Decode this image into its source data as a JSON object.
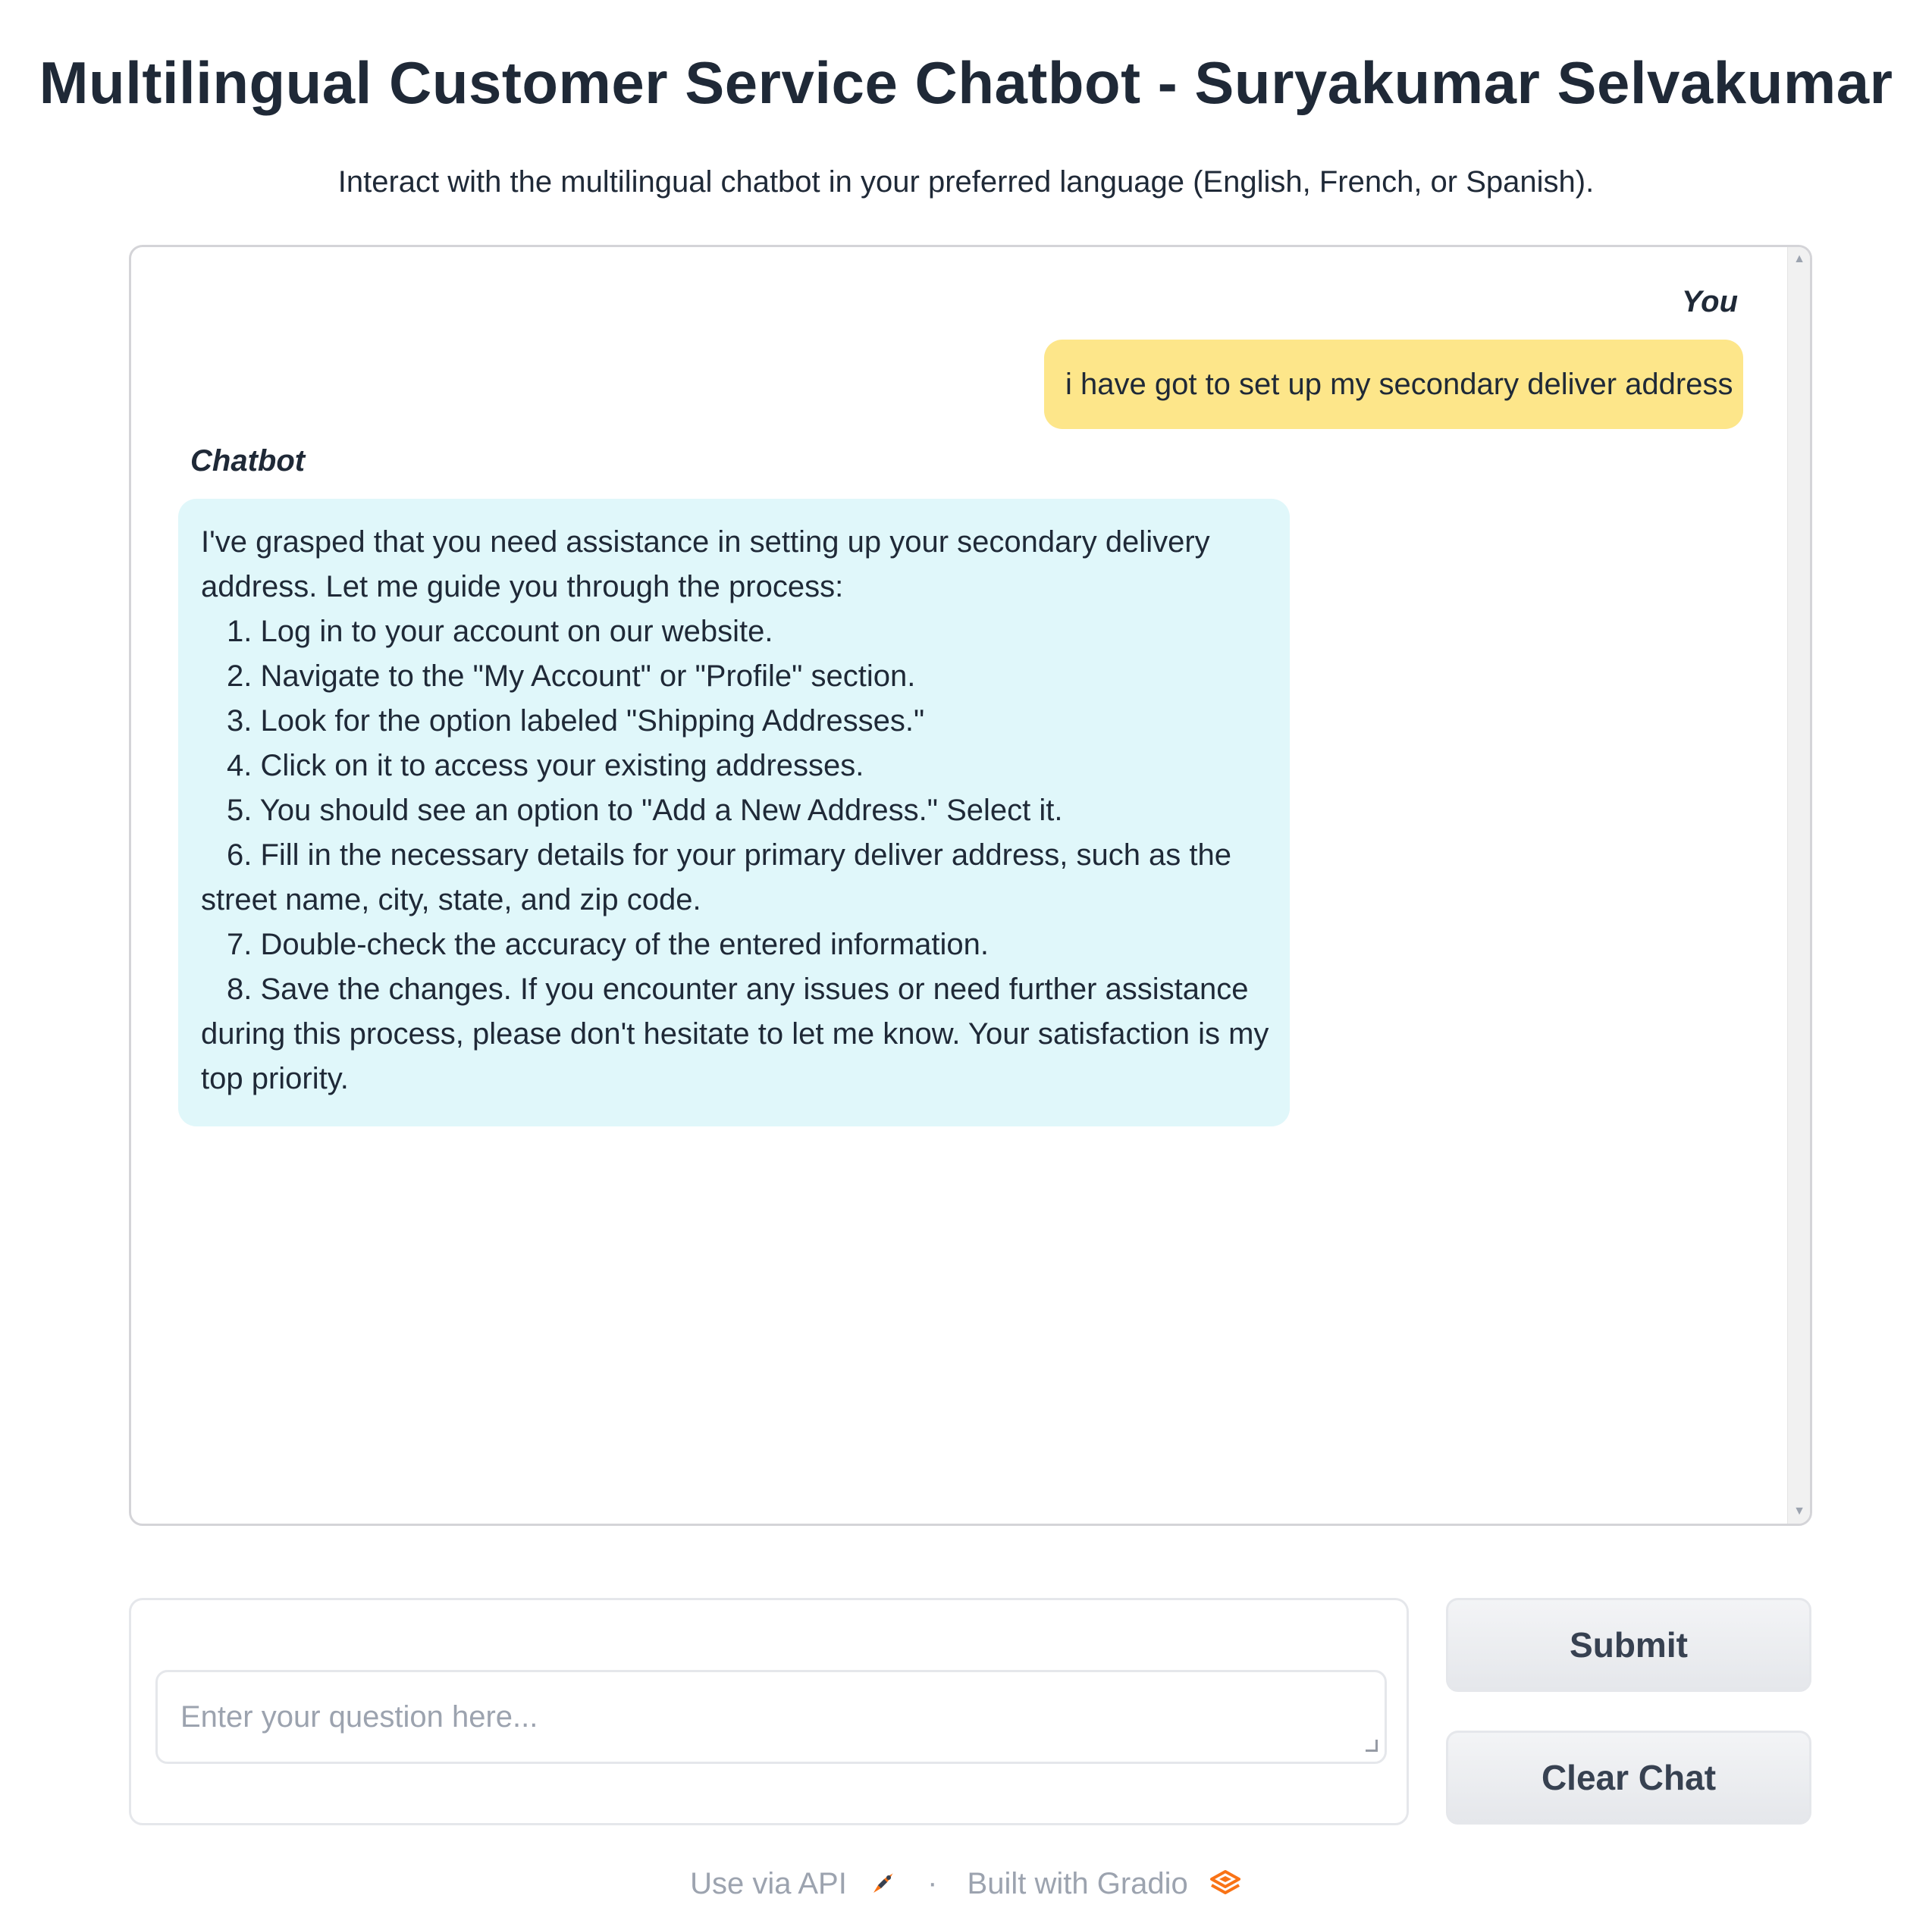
{
  "header": {
    "title": "Multilingual Customer Service Chatbot - Suryakumar Selvakumar",
    "subtitle": "Interact with the multilingual chatbot in your preferred language (English, French, or Spanish)."
  },
  "chat": {
    "user_label": "You",
    "bot_label": "Chatbot",
    "user_message": "i have got to set up my secondary deliver address",
    "bot_lines": [
      "I've grasped that you need assistance in setting up your secondary delivery",
      "address. Let me guide you through the process:"
    ],
    "bot_steps": [
      "1. Log in to your account on our website.",
      "2. Navigate to the \"My Account\" or \"Profile\" section.",
      "3. Look for the option labeled \"Shipping Addresses.\"",
      "4. Click on it to access your existing addresses.",
      "5. You should see an option to \"Add a New Address.\" Select it.",
      "6. Fill in the necessary details for your primary deliver address, such as the"
    ],
    "bot_wrap_1": "street name, city, state, and zip code.",
    "bot_steps_2": [
      "7. Double-check the accuracy of the entered information.",
      "8. Save the changes. If you encounter any issues or need further assistance"
    ],
    "bot_wrap_2": [
      "during this process, please don't hesitate to let me know. Your satisfaction is my",
      "top priority."
    ]
  },
  "input": {
    "placeholder": "Enter your question here...",
    "value": ""
  },
  "buttons": {
    "submit": "Submit",
    "clear": "Clear Chat"
  },
  "footer": {
    "api_link": "Use via API",
    "separator": "·",
    "built_with": "Built with Gradio"
  },
  "colors": {
    "user_bubble": "#fde68a",
    "bot_bubble": "#e0f7fa",
    "gradio_orange": "#f97316"
  }
}
